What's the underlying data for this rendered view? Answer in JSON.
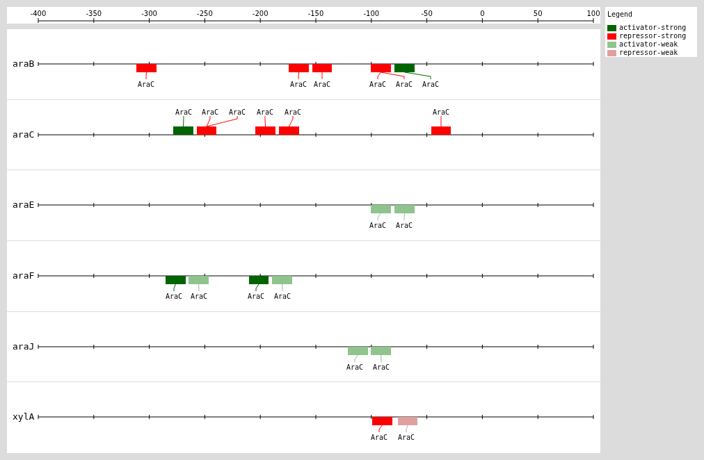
{
  "ruler": {
    "ticks": [
      "-400",
      "-350",
      "-300",
      "-250",
      "-200",
      "-150",
      "-100",
      "-50",
      "0",
      "50",
      "100"
    ]
  },
  "tracks": [
    {
      "gene": "araB",
      "sites": [
        {
          "kind": "repressor-strong",
          "label": "AraC"
        },
        {
          "kind": "repressor-strong",
          "label": "AraC"
        },
        {
          "kind": "repressor-strong",
          "label": "AraC"
        },
        {
          "kind": "repressor-strong",
          "label": "AraC"
        },
        {
          "kind": "repressor-strong",
          "label": "AraC"
        },
        {
          "kind": "activator-strong",
          "label": "AraC"
        }
      ]
    },
    {
      "gene": "araC",
      "sites": [
        {
          "kind": "activator-strong",
          "label": "AraC"
        },
        {
          "kind": "repressor-strong",
          "label": "AraC"
        },
        {
          "kind": "repressor-strong",
          "label": "AraC"
        },
        {
          "kind": "repressor-strong",
          "label": "AraC"
        },
        {
          "kind": "repressor-strong",
          "label": "AraC"
        },
        {
          "kind": "repressor-strong",
          "label": "AraC"
        }
      ]
    },
    {
      "gene": "araE",
      "sites": [
        {
          "kind": "activator-weak",
          "label": "AraC"
        },
        {
          "kind": "activator-weak",
          "label": "AraC"
        }
      ]
    },
    {
      "gene": "araF",
      "sites": [
        {
          "kind": "activator-strong",
          "label": "AraC"
        },
        {
          "kind": "activator-weak",
          "label": "AraC"
        },
        {
          "kind": "activator-strong",
          "label": "AraC"
        },
        {
          "kind": "activator-weak",
          "label": "AraC"
        }
      ]
    },
    {
      "gene": "araJ",
      "sites": [
        {
          "kind": "activator-weak",
          "label": "AraC"
        },
        {
          "kind": "activator-weak",
          "label": "AraC"
        }
      ]
    },
    {
      "gene": "xylA",
      "sites": [
        {
          "kind": "repressor-strong",
          "label": "AraC"
        },
        {
          "kind": "repressor-weak",
          "label": "AraC"
        }
      ]
    }
  ],
  "legend": {
    "title": "Legend",
    "items": [
      {
        "kind": "activator-strong",
        "label": "activator-strong",
        "color": "#006400"
      },
      {
        "kind": "repressor-strong",
        "label": "repressor-strong",
        "color": "#ff0000"
      },
      {
        "kind": "activator-weak",
        "label": "activator-weak",
        "color": "#8fc48f"
      },
      {
        "kind": "repressor-weak",
        "label": "repressor-weak",
        "color": "#e0a0a0"
      }
    ]
  }
}
